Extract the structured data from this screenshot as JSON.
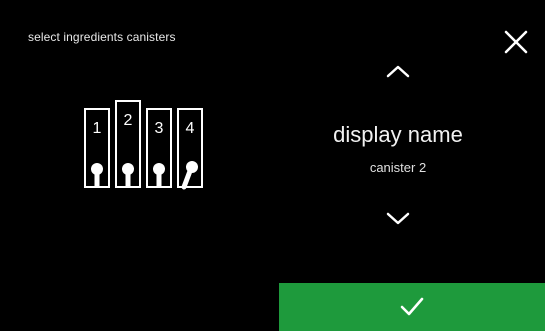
{
  "header": {
    "title": "select ingredients canisters"
  },
  "icons": {
    "close": "close-icon",
    "up": "chevron-up-icon",
    "down": "chevron-down-icon",
    "confirm": "checkmark-icon"
  },
  "canisters": [
    "1",
    "2",
    "3",
    "4"
  ],
  "selected_canister": "2",
  "setting": {
    "label": "display name",
    "value": "canister 2"
  },
  "colors": {
    "background": "#000000",
    "confirm": "#1e9a3c",
    "text": "#ffffff"
  }
}
